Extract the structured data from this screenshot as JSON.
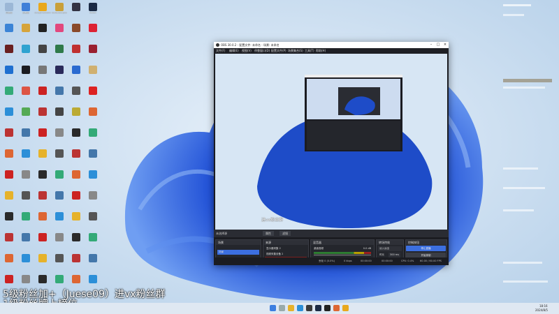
{
  "colors": {
    "wallpaper_bg": "#cfe2f2",
    "bloom_dark": "#0a2fa8",
    "bloom_mid": "#2f66e6",
    "obs_bg": "#1b1c21",
    "accent": "#3c6fe0"
  },
  "desktop_icons": [
    {
      "label": "回收站",
      "color": "#9bb7d6"
    },
    {
      "label": "此电脑",
      "color": "#3f7fd8"
    },
    {
      "label": "Google Chrome",
      "color": "#e9a81d"
    },
    {
      "label": "Gardenscapes",
      "color": "#c9a03a"
    },
    {
      "label": "",
      "color": "#334"
    },
    {
      "label": "Steam",
      "color": "#1b2a44"
    },
    {
      "label": "",
      "color": "#3b84d6"
    },
    {
      "label": "",
      "color": "#d6a43b"
    },
    {
      "label": "",
      "color": "#222"
    },
    {
      "label": "",
      "color": "#e2487e"
    },
    {
      "label": "",
      "color": "#8a4a2a"
    },
    {
      "label": "",
      "color": "#d23"
    },
    {
      "label": "",
      "color": "#6a2020"
    },
    {
      "label": "",
      "color": "#2fa3d0"
    },
    {
      "label": "",
      "color": "#444"
    },
    {
      "label": "",
      "color": "#2f7a4a"
    },
    {
      "label": "",
      "color": "#c03030"
    },
    {
      "label": "",
      "color": "#9a2030"
    },
    {
      "label": "",
      "color": "#1e6fd0"
    },
    {
      "label": "",
      "color": "#1b1c21"
    },
    {
      "label": "",
      "color": "#777"
    },
    {
      "label": "",
      "color": "#2a2a5a"
    },
    {
      "label": "",
      "color": "#2a6ad0"
    },
    {
      "label": "",
      "color": "#d0b070"
    },
    {
      "label": "",
      "color": "#3a7"
    },
    {
      "label": "",
      "color": "#d54"
    },
    {
      "label": "",
      "color": "#c22"
    },
    {
      "label": "",
      "color": "#47a"
    },
    {
      "label": "",
      "color": "#555"
    },
    {
      "label": "",
      "color": "#d22"
    },
    {
      "label": "",
      "color": "#2c8fd8"
    },
    {
      "label": "",
      "color": "#5a5"
    },
    {
      "label": "",
      "color": "#b33"
    },
    {
      "label": "",
      "color": "#444"
    },
    {
      "label": "",
      "color": "#ba3"
    },
    {
      "label": "",
      "color": "#d63"
    }
  ],
  "obs": {
    "title": "OBS 30.0.2 - 配置文件: 未命名 - 场景: 未命名",
    "menu": [
      "文件(F)",
      "编辑(E)",
      "视图(V)",
      "停靠窗口(D)",
      "配置文件(P)",
      "场景集合(S)",
      "工具(T)",
      "帮助(H)"
    ],
    "no_source": "未选择源",
    "ctx_buttons": [
      "属性",
      "滤镜"
    ],
    "docks": {
      "scenes": "场景",
      "sources": "来源",
      "mixer": "混音器",
      "transitions": "转场特效",
      "controls": "控制按钮"
    },
    "scene_item": "场景",
    "sources": [
      "显示器采集 2",
      "视频采集设备 2",
      "显示器采集 3",
      "显示器采集",
      "窗口采集",
      "浏览器 2",
      "显示器采集 4"
    ],
    "mixer": [
      {
        "name": "桌面音频",
        "db": "0.0 dB"
      },
      {
        "name": "麦克风/Aux",
        "db": "0.0 dB"
      }
    ],
    "transition": {
      "type": "淡入淡出",
      "duration_label": "时长",
      "duration": "300 ms"
    },
    "controls": [
      "停止直播",
      "开始录制",
      "启动虚拟摄像机",
      "工作室模式",
      "设置",
      "退出"
    ],
    "status": {
      "frames": "丢帧 0 (0.0%)",
      "bitrate": "0 kbps",
      "live": "00:00:00",
      "rec": "00:00:00",
      "cpu": "CPU: 0.4%",
      "fps": "60.00 / 60.00 FPS"
    },
    "inner_watermark": "进vx粉丝群"
  },
  "subtitle_line1": "5级粉丝加+（Juese09）进vx粉丝群",
  "subtitle_line2": "1级粉丝牌上榜位",
  "taskbar": {
    "time": "18:16",
    "date": "2024/8/5"
  }
}
